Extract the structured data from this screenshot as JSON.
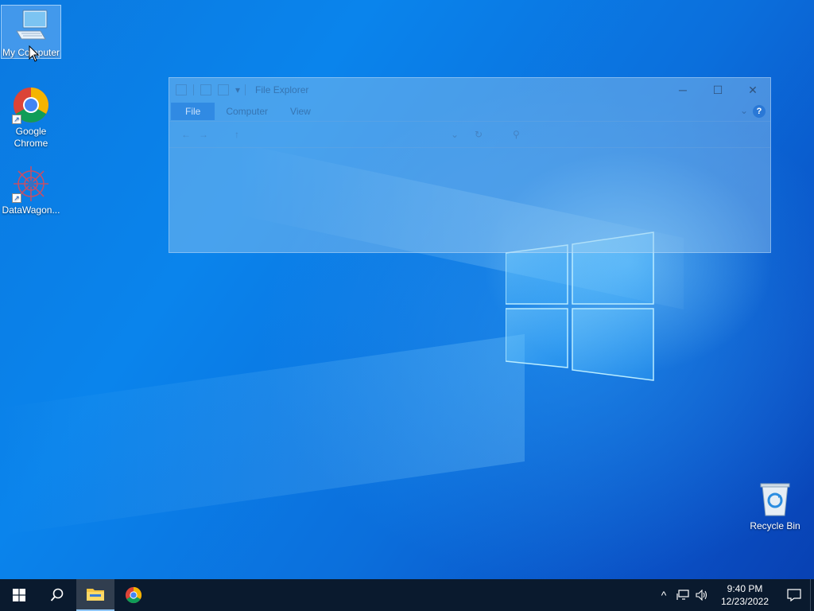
{
  "desktop": {
    "icons": [
      {
        "label": "My Computer",
        "icon": "computer-icon",
        "selected": true
      },
      {
        "label": "Google\nChrome",
        "label_line1": "Google",
        "label_line2": "Chrome",
        "icon": "chrome-icon",
        "shortcut": true
      },
      {
        "label": "DataWagon...",
        "icon": "datawagon-icon",
        "shortcut": true
      },
      {
        "label": "Recycle Bin",
        "icon": "recycle-bin-icon"
      }
    ]
  },
  "explorer": {
    "title": "File Explorer",
    "tabs": [
      "File",
      "Computer",
      "View"
    ],
    "help": "?",
    "minimize": "─",
    "maximize": "☐",
    "close": "✕"
  },
  "taskbar": {
    "apps": [
      {
        "name": "start",
        "icon": "windows-start-icon"
      },
      {
        "name": "search",
        "icon": "search-icon"
      },
      {
        "name": "file-explorer",
        "icon": "folder-icon",
        "active": true
      },
      {
        "name": "chrome",
        "icon": "chrome-icon"
      }
    ],
    "tray": {
      "chevron": "^",
      "time": "9:40 PM",
      "date": "12/23/2022"
    }
  },
  "colors": {
    "accent": "#0a84ec",
    "taskbar": "#0a1a2e"
  }
}
